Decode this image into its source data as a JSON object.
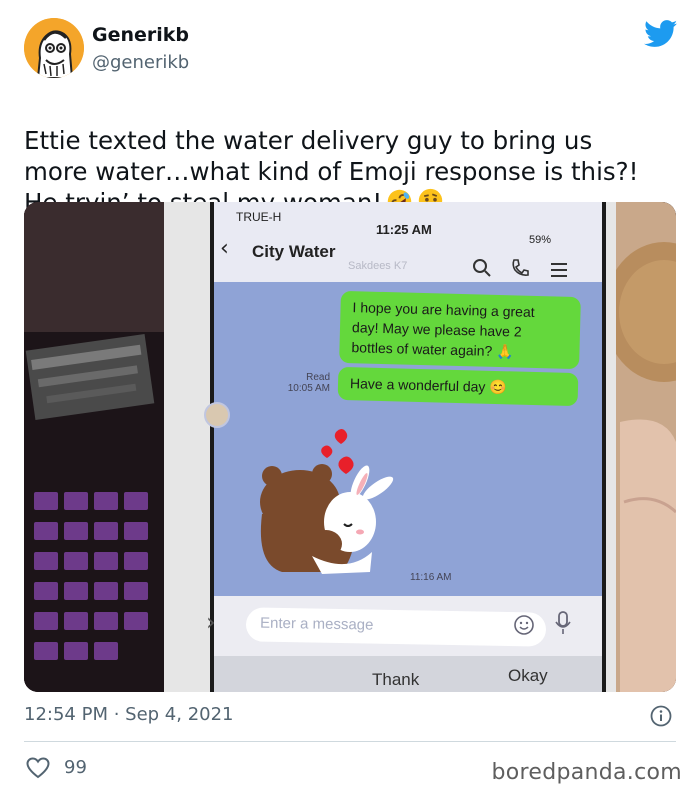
{
  "tweet": {
    "author_name": "Generikb",
    "author_handle": "@generikb",
    "text": "Ettie texted the water delivery guy to bring us\nmore water…what kind of Emoji response is this?!\nHe tryin’ to steal my woman!",
    "emojis": [
      "rolling-on-floor-laughing-emoji",
      "thinking-face-emoji"
    ],
    "timestamp": "12:54 PM · Sep 4, 2021",
    "likes": "99"
  },
  "phone": {
    "carrier": "TRUE-H",
    "time": "11:25 AM",
    "battery": "59%",
    "chat_title": "City Water",
    "chat_subtitle": "Sakdees K7",
    "message_1": "I hope you are having a great\nday! May we please have 2\nbottles of water again?",
    "message_2": "Have a wonderful day",
    "read_label": "Read",
    "read_time": "10:05 AM",
    "sticker_time": "11:16 AM",
    "input_placeholder": "Enter a message",
    "suggestion_1": "Thank",
    "suggestion_2": "Okay"
  },
  "watermark": "boredpanda.com",
  "colors": {
    "text": "#0f1419",
    "secondary": "#536471",
    "twitter_blue": "#1d9bf0",
    "chat_bg": "#8fa3d6",
    "bubble_green": "#64d83c"
  }
}
